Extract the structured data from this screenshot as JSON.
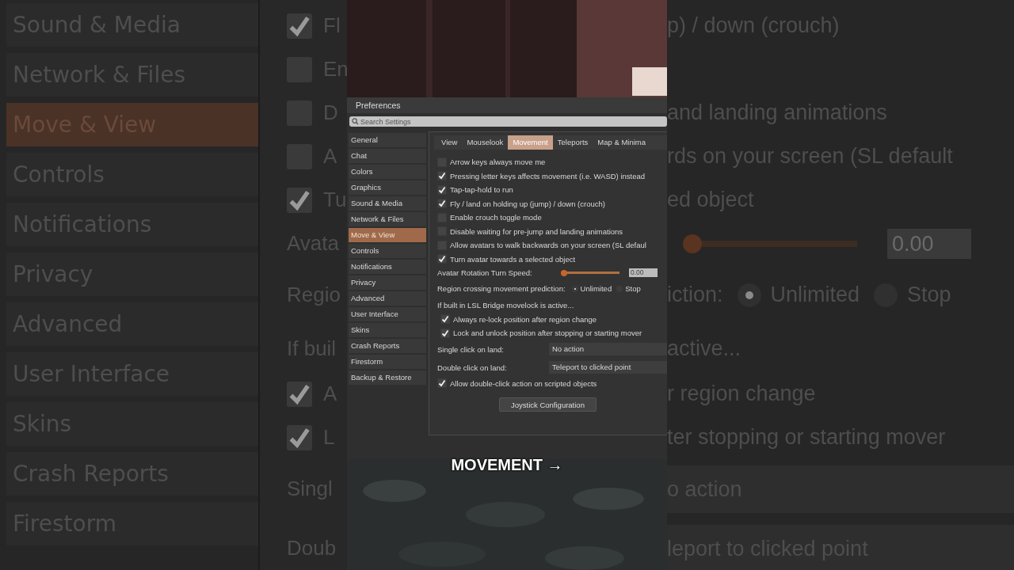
{
  "backdrop_left": {
    "sidebar": [
      {
        "label": "Sound & Media",
        "selected": false
      },
      {
        "label": "Network & Files",
        "selected": false
      },
      {
        "label": "Move & View",
        "selected": true
      },
      {
        "label": "Controls",
        "selected": false
      },
      {
        "label": "Notifications",
        "selected": false
      },
      {
        "label": "Privacy",
        "selected": false
      },
      {
        "label": "Advanced",
        "selected": false
      },
      {
        "label": "User Interface",
        "selected": false
      },
      {
        "label": "Skins",
        "selected": false
      },
      {
        "label": "Crash Reports",
        "selected": false
      },
      {
        "label": "Firestorm",
        "selected": false
      }
    ]
  },
  "backdrop_rows": [
    {
      "kind": "checkbox",
      "left": "Fl",
      "right": "p) / down (crouch)",
      "checked": true
    },
    {
      "kind": "checkbox",
      "left": "En",
      "checked": false
    },
    {
      "kind": "checkbox",
      "left": "D",
      "right": "and landing animations",
      "checked": false
    },
    {
      "kind": "checkbox",
      "left": "A",
      "right": "rds on your screen (SL default",
      "checked": false
    },
    {
      "kind": "checkbox",
      "left": "Tu",
      "right": "ed object",
      "checked": true
    },
    {
      "kind": "slider",
      "left": "Avata",
      "level": 0,
      "value": "0.00"
    },
    {
      "kind": "radio",
      "left": "Regio",
      "right": "iction:",
      "options": [
        {
          "label": "Unlimited",
          "selected": true
        },
        {
          "label": "Stop",
          "selected": false
        }
      ]
    },
    {
      "kind": "label",
      "left": "If buil",
      "right": "active..."
    },
    {
      "kind": "checkbox",
      "left": "A",
      "right": "r region change",
      "checked": true
    },
    {
      "kind": "checkbox",
      "left": "L",
      "right": "ter stopping or starting mover",
      "checked": true
    },
    {
      "kind": "dropdown",
      "left": "Singl",
      "right": "o action"
    },
    {
      "kind": "dropdown",
      "left": "Doub",
      "right": "leport to clicked point"
    }
  ],
  "video": {
    "caption": "MOVEMENT →"
  },
  "dialog": {
    "title": "Preferences",
    "search": {
      "placeholder": "Search Settings"
    },
    "sidebar": [
      {
        "label": "General",
        "selected": false
      },
      {
        "label": "Chat",
        "selected": false
      },
      {
        "label": "Colors",
        "selected": false
      },
      {
        "label": "Graphics",
        "selected": false
      },
      {
        "label": "Sound & Media",
        "selected": false
      },
      {
        "label": "Network & Files",
        "selected": false
      },
      {
        "label": "Move & View",
        "selected": true
      },
      {
        "label": "Controls",
        "selected": false
      },
      {
        "label": "Notifications",
        "selected": false
      },
      {
        "label": "Privacy",
        "selected": false
      },
      {
        "label": "Advanced",
        "selected": false
      },
      {
        "label": "User Interface",
        "selected": false
      },
      {
        "label": "Skins",
        "selected": false
      },
      {
        "label": "Crash Reports",
        "selected": false
      },
      {
        "label": "Firestorm",
        "selected": false
      },
      {
        "label": "Backup & Restore",
        "selected": false
      }
    ],
    "tabs": [
      {
        "label": "View",
        "selected": false
      },
      {
        "label": "Mouselook",
        "selected": false
      },
      {
        "label": "Movement",
        "selected": true
      },
      {
        "label": "Teleports",
        "selected": false
      },
      {
        "label": "Map & Minima",
        "selected": false
      }
    ],
    "rows": [
      {
        "kind": "checkbox",
        "text": "Arrow keys always move me",
        "checked": false
      },
      {
        "kind": "checkbox",
        "text": "Pressing letter keys affects movement (i.e. WASD) instead",
        "checked": true
      },
      {
        "kind": "checkbox",
        "text": "Tap-tap-hold to run",
        "checked": true
      },
      {
        "kind": "checkbox",
        "text": "Fly / land on holding up (jump) / down (crouch)",
        "checked": true
      },
      {
        "kind": "checkbox",
        "text": "Enable crouch toggle mode",
        "checked": false
      },
      {
        "kind": "checkbox",
        "text": "Disable waiting for pre-jump and landing animations",
        "checked": false
      },
      {
        "kind": "checkbox",
        "text": "Allow avatars to walk backwards on your screen (SL defaul",
        "checked": false
      },
      {
        "kind": "checkbox",
        "text": "Turn avatar towards a selected object",
        "checked": true
      },
      {
        "kind": "slider",
        "text": "Avatar Rotation Turn Speed:",
        "level": 0,
        "value": "0.00"
      },
      {
        "kind": "radio",
        "text": "Region crossing movement prediction:",
        "options": [
          {
            "label": "Unlimited",
            "selected": true
          },
          {
            "label": "Stop",
            "selected": false
          }
        ]
      },
      {
        "kind": "label",
        "text": "If built in LSL Bridge movelock is active..."
      },
      {
        "kind": "subcheckbox",
        "text": "Always re-lock position after region change",
        "checked": true
      },
      {
        "kind": "subcheckbox",
        "text": "Lock and unlock position after stopping or starting mover",
        "checked": true
      },
      {
        "kind": "dropdown",
        "text": "Single click on land:",
        "value": "No action"
      },
      {
        "kind": "dropdown",
        "text": "Double click on land:",
        "value": "Teleport to clicked point"
      },
      {
        "kind": "checkbox",
        "text": "Allow double-click action on scripted objects",
        "checked": true
      }
    ],
    "button": "Joystick Configuration"
  }
}
